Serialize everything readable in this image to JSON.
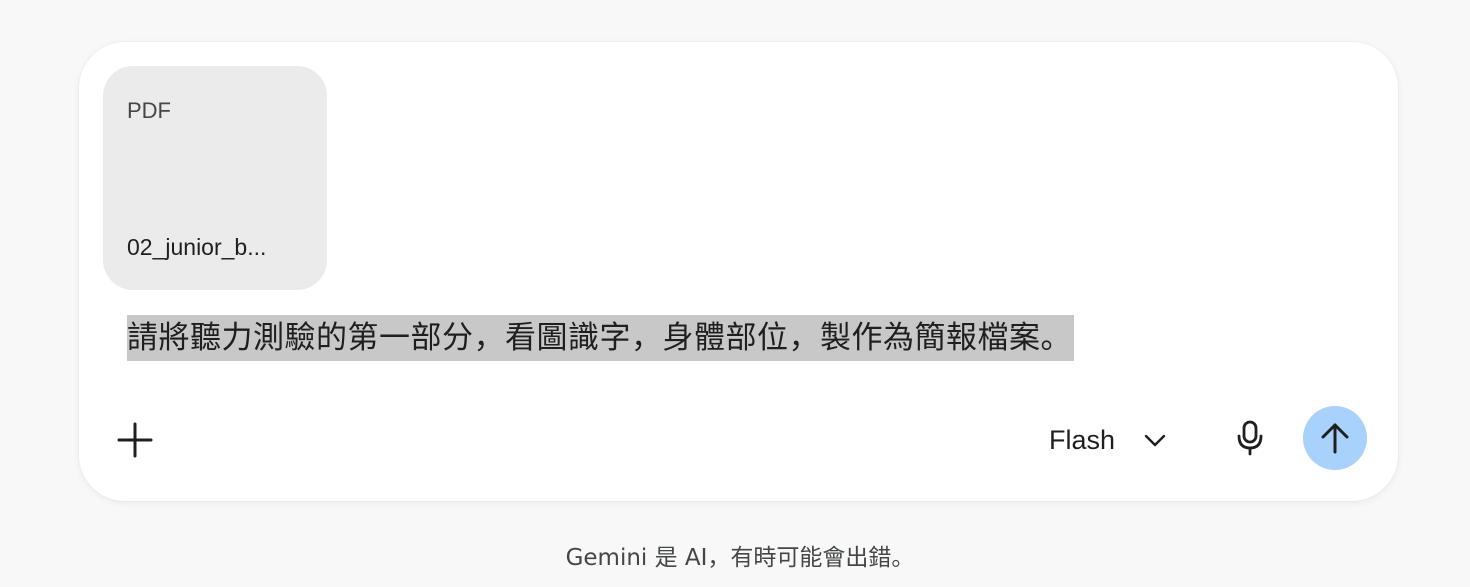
{
  "attachment": {
    "type_label": "PDF",
    "file_name": "02_junior_b..."
  },
  "prompt": {
    "text": "請將聽力測驗的第一部分，看圖識字，身體部位，製作為簡報檔案。"
  },
  "toolbar": {
    "add_icon": "plus-icon",
    "model_label": "Flash",
    "model_chevron_icon": "chevron-down-icon",
    "mic_icon": "microphone-icon",
    "send_icon": "arrow-up-icon"
  },
  "footer": {
    "disclaimer": "Gemini 是 AI，有時可能會出錯。"
  },
  "colors": {
    "page_background": "#f8f8f8",
    "composer_background": "#ffffff",
    "attachment_background": "#ebebeb",
    "selection_highlight": "#c8c8c8",
    "send_button": "#a8d1fb"
  }
}
